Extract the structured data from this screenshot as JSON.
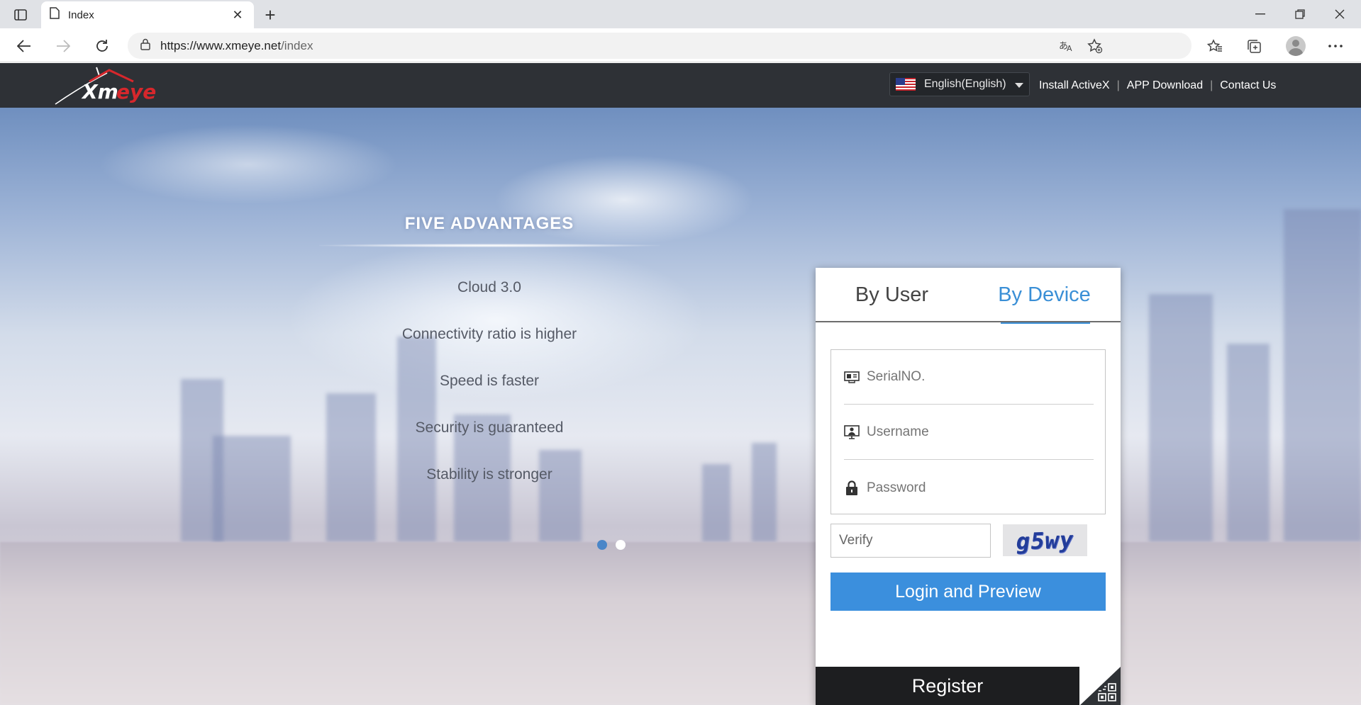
{
  "browser": {
    "tab_title": "Index",
    "tab_close": "✕",
    "new_tab": "+",
    "url_host": "https://www.xmeye.net",
    "url_path": "/index",
    "window_controls": [
      "minimize-icon",
      "restore-icon",
      "close-icon"
    ]
  },
  "header": {
    "logo_text": "Xmeye",
    "language": "English(English)",
    "links": [
      "Install ActiveX",
      "APP Download",
      "Contact Us"
    ],
    "separator": "|"
  },
  "advantages": {
    "title": "FIVE ADVANTAGES",
    "items": [
      "Cloud 3.0",
      "Connectivity ratio is higher",
      "Speed is faster",
      "Security is guaranteed",
      "Stability is stronger"
    ],
    "slide_count": 2,
    "active_slide": 1
  },
  "login": {
    "tabs": [
      "By User",
      "By Device"
    ],
    "active_tab": "By Device",
    "serial_placeholder": "SerialNO.",
    "username_placeholder": "Username",
    "password_placeholder": "Password",
    "verify_placeholder": "Verify",
    "captcha_text": "g5wy",
    "login_button": "Login and Preview",
    "register_button": "Register"
  },
  "colors": {
    "accent": "#3a8fd6",
    "header_bg": "#2e3136",
    "register_bg": "#1d1e20"
  }
}
